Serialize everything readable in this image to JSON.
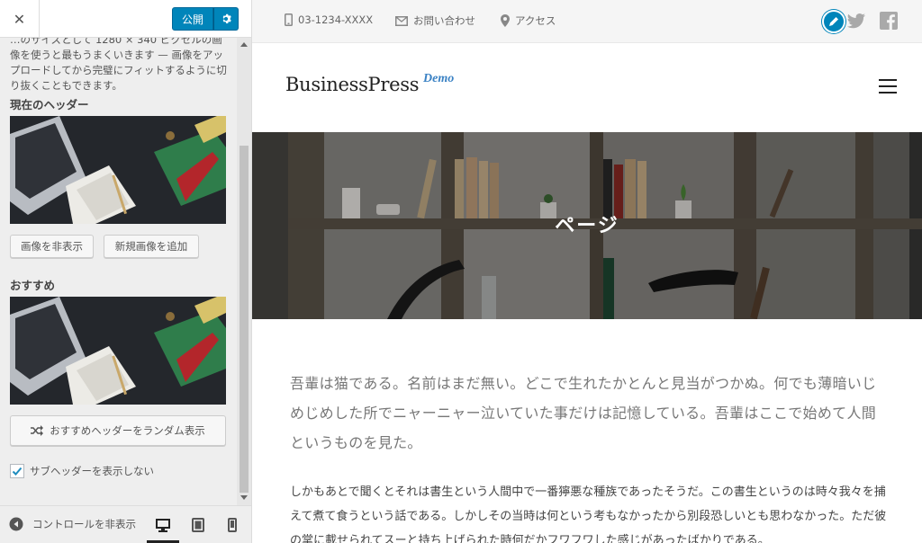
{
  "panel": {
    "close_label": "✕",
    "publish_label": "公開",
    "description": "…のサイズとして 1280 × 340 ピクセルの画像を使うと最もうまくいきます — 画像をアップロードしてから完璧にフィットするように切り抜くこともできます。",
    "current_header_label": "現在のヘッダー",
    "hide_image_label": "画像を非表示",
    "add_new_image_label": "新規画像を追加",
    "suggested_label": "おすすめ",
    "randomize_label": "おすすめヘッダーをランダム表示",
    "hide_subheader_label": "サブヘッダーを表示しない",
    "hide_subheader_checked": true,
    "collapse_label": "コントロールを非表示",
    "accent_color": "#0085ba"
  },
  "topbar": {
    "phone": "03-1234-XXXX",
    "contact": "お問い合わせ",
    "access": "アクセス"
  },
  "site": {
    "logo": "BusinessPress",
    "logo_demo": "Demo",
    "hero_title": "ページ"
  },
  "content": {
    "lead": "吾輩は猫である。名前はまだ無い。どこで生れたかとんと見当がつかぬ。何でも薄暗いじめじめした所でニャーニャー泣いていた事だけは記憶している。吾輩はここで始めて人間というものを見た。",
    "body": "しかもあとで聞くとそれは書生という人間中で一番獰悪な種族であったそうだ。この書生というのは時々我々を捕えて煮て食うという話である。しかしその当時は何という考もなかったから別段恐しいとも思わなかった。ただ彼の掌に載せられてスーと持ち上げられた時何だかフワフワした感じがあったばかりである。"
  }
}
